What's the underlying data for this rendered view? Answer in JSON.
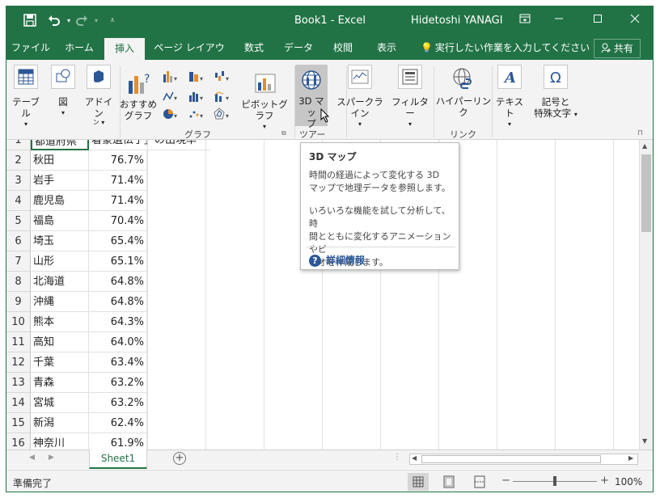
{
  "titlebar": {
    "title": "Book1  -  Excel",
    "user": "Hidetoshi YANAGI",
    "qat": [
      "save-icon",
      "undo-icon",
      "redo-icon",
      "customize-icon"
    ]
  },
  "tabs": [
    {
      "label": "ファイル"
    },
    {
      "label": "ホーム"
    },
    {
      "label": "挿入"
    },
    {
      "label": "ページ レイアウト"
    },
    {
      "label": "数式"
    },
    {
      "label": "データ"
    },
    {
      "label": "校閲"
    },
    {
      "label": "表示"
    }
  ],
  "tellme": "実行したい作業を入力してください",
  "share": "共有",
  "ribbon": {
    "table": "テーブル",
    "illustration": "図",
    "addin": "アドイン",
    "recommended": [
      "おすすめ",
      "グラフ"
    ],
    "pivotchart": "ピボットグラフ",
    "map3d": [
      "3D マッ",
      "プ"
    ],
    "sparkline": "スパークライン",
    "filter": "フィルター",
    "hyperlink": "ハイパーリンク",
    "text": "テキスト",
    "symbol": [
      "記号と",
      "特殊文字"
    ],
    "groups": {
      "graph": "グラフ",
      "tour": "ツアー",
      "link": "リンク"
    }
  },
  "sheet": {
    "header_row": {
      "num": "1",
      "a": "都道府県",
      "b": "着豪遺伝子」の出現率"
    },
    "rows": [
      {
        "num": "2",
        "pref": "秋田",
        "val": "76.7%"
      },
      {
        "num": "3",
        "pref": "岩手",
        "val": "71.4%"
      },
      {
        "num": "4",
        "pref": "鹿児島",
        "val": "71.4%"
      },
      {
        "num": "5",
        "pref": "福島",
        "val": "70.4%"
      },
      {
        "num": "6",
        "pref": "埼玉",
        "val": "65.4%"
      },
      {
        "num": "7",
        "pref": "山形",
        "val": "65.1%"
      },
      {
        "num": "8",
        "pref": "北海道",
        "val": "64.8%"
      },
      {
        "num": "9",
        "pref": "沖縄",
        "val": "64.8%"
      },
      {
        "num": "10",
        "pref": "熊本",
        "val": "64.3%"
      },
      {
        "num": "11",
        "pref": "高知",
        "val": "64.0%"
      },
      {
        "num": "12",
        "pref": "千葉",
        "val": "63.4%"
      },
      {
        "num": "13",
        "pref": "青森",
        "val": "63.2%"
      },
      {
        "num": "14",
        "pref": "宮城",
        "val": "63.2%"
      },
      {
        "num": "15",
        "pref": "新潟",
        "val": "62.4%"
      },
      {
        "num": "16",
        "pref": "神奈川",
        "val": "61.9%"
      }
    ]
  },
  "tooltip": {
    "title": "3D マップ",
    "p1": [
      "時間の経過によって変化する 3D",
      "マップで地理データを参照します。"
    ],
    "p2": [
      "いろいろな機能を試して分析して、時",
      "間とともに変化するアニメーションやビ",
      "デオを作成します。"
    ],
    "more": "詳細情報"
  },
  "sheet_tab": "Sheet1",
  "status": {
    "ready": "準備完了",
    "zoom": "100%"
  },
  "colors": {
    "accent": "#217346",
    "tab_text": "#217346"
  }
}
